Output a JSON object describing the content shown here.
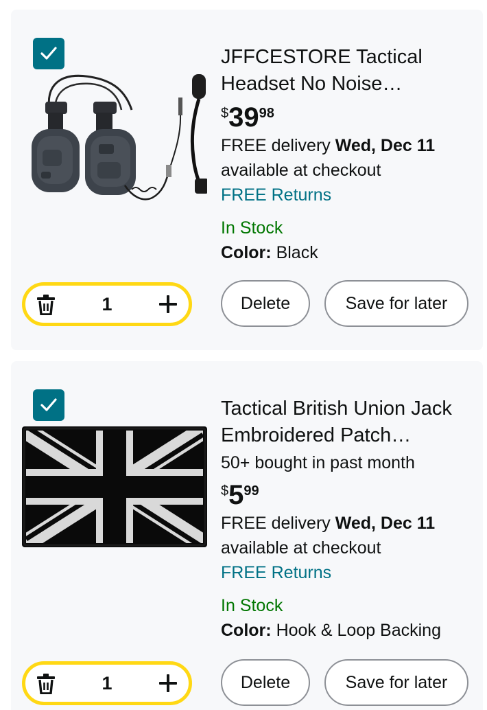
{
  "items": [
    {
      "selected": true,
      "image_alt": "Tactical headset with boom microphone",
      "title": "JFFCESTORE Tactical Headset No Noise Reduction...",
      "bought": "",
      "price": {
        "symbol": "$",
        "whole": "39",
        "fraction": "98"
      },
      "delivery_prefix": "FREE delivery ",
      "delivery_date": "Wed, Dec 11",
      "delivery_note": "available at checkout",
      "returns": "FREE Returns",
      "stock": "In Stock",
      "color_label": "Color:",
      "color_value": "Black",
      "quantity": "1",
      "delete_label": "Delete",
      "save_label": "Save for later"
    },
    {
      "selected": true,
      "image_alt": "Black and white Union Jack embroidered patch",
      "title": "Tactical British Union Jack Embroidered Patch England...",
      "bought": "50+ bought in past month",
      "price": {
        "symbol": "$",
        "whole": "5",
        "fraction": "99"
      },
      "delivery_prefix": "FREE delivery ",
      "delivery_date": "Wed, Dec 11",
      "delivery_note": "available at checkout",
      "returns": "FREE Returns",
      "stock": "In Stock",
      "color_label": "Color:",
      "color_value": "Hook & Loop Backing",
      "quantity": "1",
      "delete_label": "Delete",
      "save_label": "Save for later"
    }
  ],
  "colors": {
    "accent_teal": "#007185",
    "stock_green": "#007600",
    "qty_border_yellow": "#ffd814",
    "card_bg": "#f7f8fa"
  },
  "icons": {
    "checkbox": "checkmark-icon",
    "delete_qty": "trash-icon",
    "increase_qty": "plus-icon"
  }
}
